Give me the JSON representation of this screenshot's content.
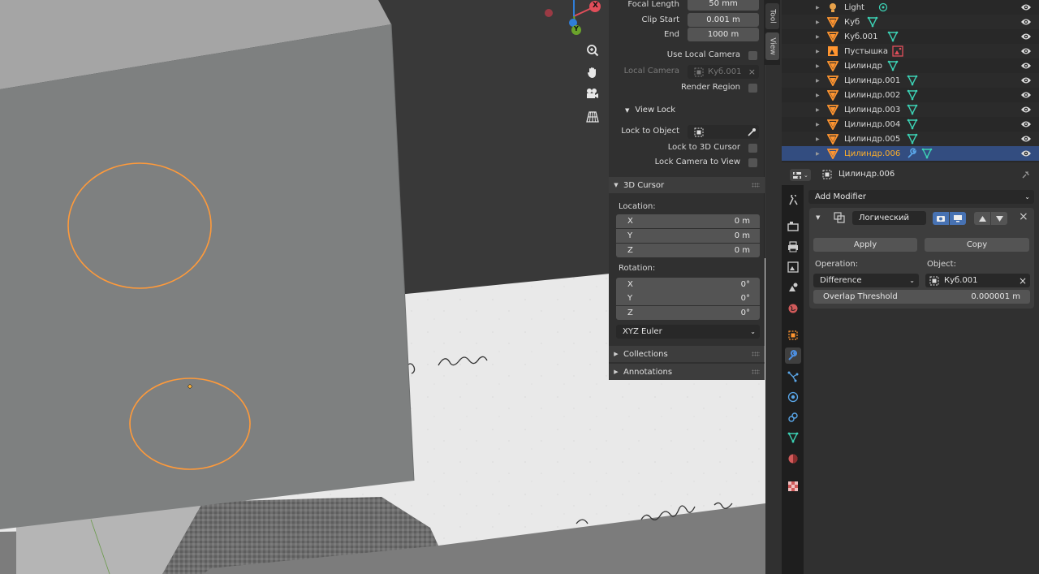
{
  "npanel": {
    "tabs": [
      "Tool",
      "View"
    ],
    "focal_length_label": "Focal Length",
    "focal_length_value": "50 mm",
    "clip_start_label": "Clip Start",
    "clip_start_value": "0.001 m",
    "clip_end_label": "End",
    "clip_end_value": "1000 m",
    "use_local_camera_label": "Use Local Camera",
    "local_camera_label": "Local Camera",
    "local_camera_value": "Куб.001",
    "render_region_label": "Render Region",
    "view_lock_label": "View Lock",
    "lock_to_object_label": "Lock to Object",
    "lock_to_cursor_label": "Lock to 3D Cursor",
    "lock_camera_label": "Lock Camera to View",
    "cursor_panel_label": "3D Cursor",
    "location_label": "Location:",
    "location": [
      {
        "axis": "X",
        "value": "0 m"
      },
      {
        "axis": "Y",
        "value": "0 m"
      },
      {
        "axis": "Z",
        "value": "0 m"
      }
    ],
    "rotation_label": "Rotation:",
    "rotation": [
      {
        "axis": "X",
        "value": "0°"
      },
      {
        "axis": "Y",
        "value": "0°"
      },
      {
        "axis": "Z",
        "value": "0°"
      }
    ],
    "rotation_mode": "XYZ Euler",
    "collections_label": "Collections",
    "annotations_label": "Annotations"
  },
  "outliner": {
    "items": [
      {
        "name": "Light",
        "type": "light",
        "data": "light-data"
      },
      {
        "name": "Куб",
        "type": "mesh",
        "data": "mesh-data"
      },
      {
        "name": "Куб.001",
        "type": "mesh",
        "data": "mesh-data"
      },
      {
        "name": "Пустышка",
        "type": "empty",
        "data": "image-data"
      },
      {
        "name": "Цилиндр",
        "type": "mesh",
        "data": "mesh-data"
      },
      {
        "name": "Цилиндр.001",
        "type": "mesh",
        "data": "mesh-data"
      },
      {
        "name": "Цилиндр.002",
        "type": "mesh",
        "data": "mesh-data"
      },
      {
        "name": "Цилиндр.003",
        "type": "mesh",
        "data": "mesh-data"
      },
      {
        "name": "Цилиндр.004",
        "type": "mesh",
        "data": "mesh-data"
      },
      {
        "name": "Цилиндр.005",
        "type": "mesh",
        "data": "mesh-data"
      },
      {
        "name": "Цилиндр.006",
        "type": "mesh",
        "data": "mesh-data",
        "selected": true
      }
    ]
  },
  "properties": {
    "object_name": "Цилиндр.006",
    "add_modifier_label": "Add Modifier",
    "modifier_name": "Логический",
    "apply_label": "Apply",
    "copy_label": "Copy",
    "operation_label": "Operation:",
    "operation_value": "Difference",
    "object_label": "Object:",
    "object_value": "Куб.001",
    "overlap_label": "Overlap Threshold",
    "overlap_value": "0.000001 m"
  },
  "gizmo": {
    "x_label": "X",
    "y_label": "Y"
  },
  "colors": {
    "accent_orange": "#ffaf29",
    "selection_blue": "#334d80",
    "axis_red": "#e14e5a",
    "axis_green": "#6ba32b",
    "axis_blue": "#2f7ed8",
    "mesh_data_teal": "#3cd1b4",
    "object_orange": "#ff9530"
  }
}
